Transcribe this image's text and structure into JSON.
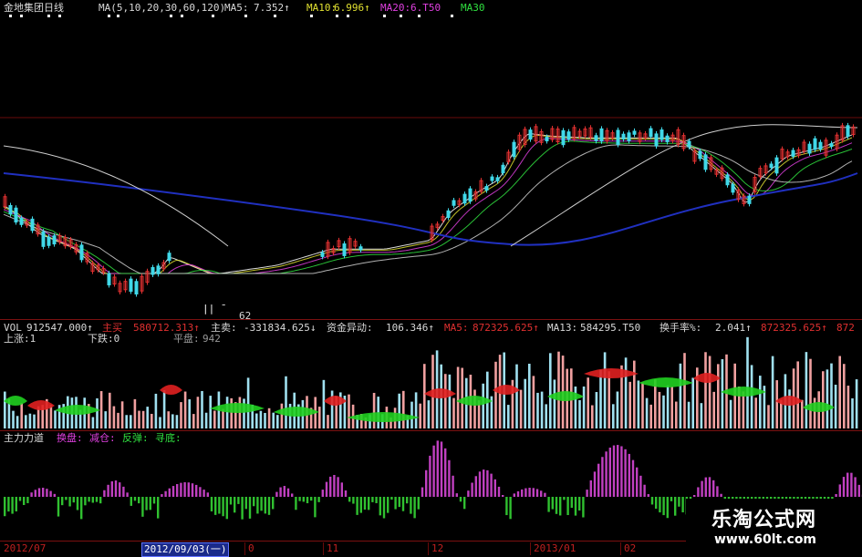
{
  "header": {
    "stock_name": "金地集团日线",
    "ma_params": "MA(5,10,20,30,60,120)",
    "ma5_label": "MA5:",
    "ma5_value": "7.352↑",
    "ma10_label": "MA10:",
    "ma10_value": "6.996↑",
    "ma20_label": "MA20:",
    "ma20_value": "6.T50",
    "ma30_label": "MA30"
  },
  "price_panel": {
    "low_marker": "62"
  },
  "volume_header": {
    "vol_label": "VOL",
    "vol_value": "912547.000↑",
    "main_buy_label": "主买",
    "main_buy_value": "580712.313↑",
    "main_sell_label": "主卖:",
    "main_sell_value": "-331834.625↓",
    "capital_label": "资金异动:",
    "capital_value": "106.346↑",
    "ma5_label": "MA5:",
    "ma5_value": "872325.625↑",
    "ma13_label": "MA13:",
    "ma13_value": "584295.T50",
    "turnover_label": "换手率%:",
    "turnover_value": "2.041↑",
    "extra_value": "872325.625↑",
    "extra_value2": "872"
  },
  "count_row": {
    "up_label": "上涨:1",
    "down_label": "下跌:0",
    "flat_label": "平盘:",
    "flat_value": "942"
  },
  "force_header": {
    "title": "主力力道",
    "swap": "换盘:",
    "reduce": "减仓:",
    "rebound": "反弹:",
    "bottom": "寻底:"
  },
  "dates": [
    "2012/07",
    "2012/09/03(一)",
    "0",
    "11",
    "12",
    "2013/01",
    "02"
  ],
  "watermark": {
    "title": "乐淘公式网",
    "url": "www.60lt.com"
  },
  "colors": {
    "background": "#000000",
    "up": "#e03030",
    "down": "#40d8e8",
    "ma5": "#ffffff",
    "ma10": "#e0e030",
    "ma20": "#e040e0",
    "ma30": "#30e040",
    "ma60": "#d0d0d0",
    "ma120": "#2030c0",
    "force_positive": "#c040c0",
    "force_negative": "#30c030"
  }
}
